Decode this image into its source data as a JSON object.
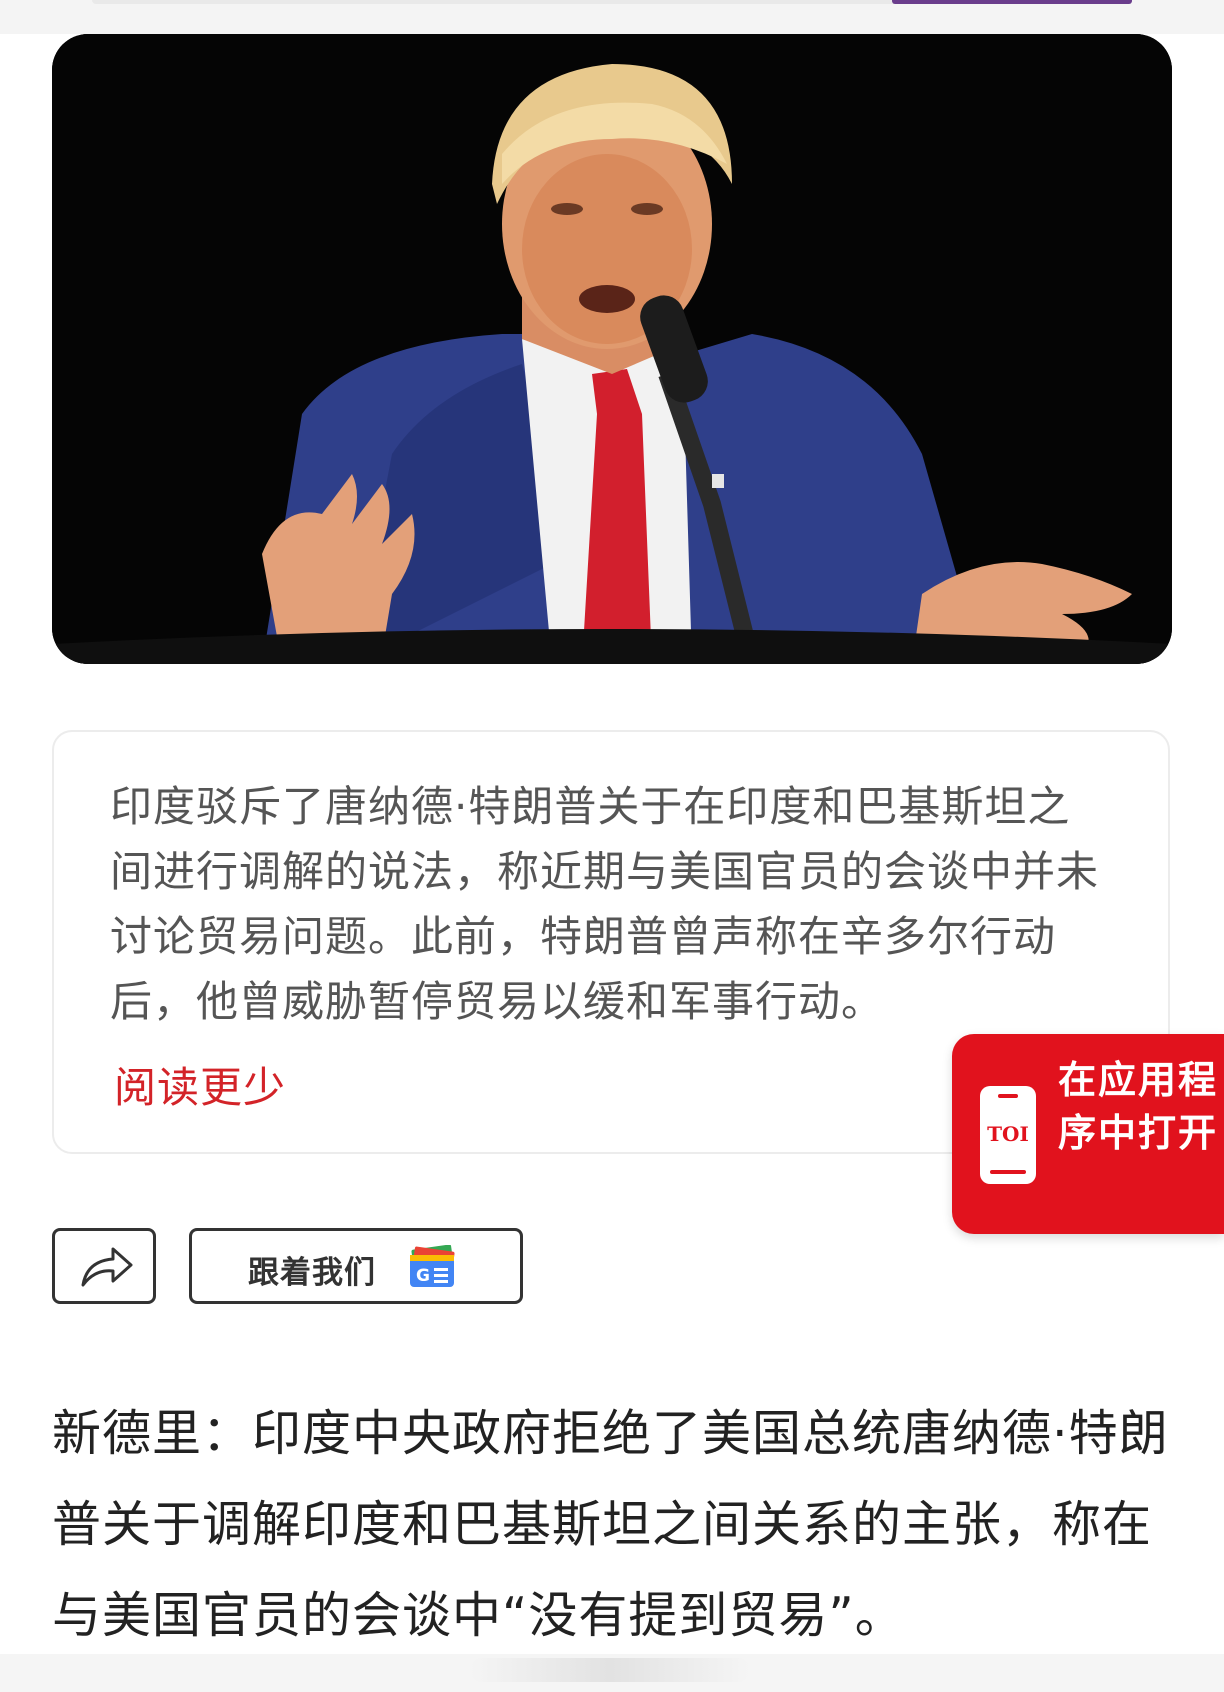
{
  "hero": {
    "image_alt": "",
    "image_icon": "speaker-at-microphone-photo"
  },
  "summary": {
    "text": "印度驳斥了唐纳德·特朗普关于在印度和巴基斯坦之间进行调解的说法，称近期与美国官员的会谈中并未讨论贸易问题。此前，特朗普曾声称在辛多尔行动后，他曾威胁暂停贸易以缓和军事行动。",
    "read_less_label": "阅读更少"
  },
  "open_app": {
    "label": "在应用程序中打开",
    "logo_text": "TOI",
    "brand_color": "#e1121d"
  },
  "actions": {
    "share_icon": "share-arrow-icon",
    "follow_label": "跟着我们",
    "follow_icon": "google-news-icon"
  },
  "article": {
    "body": "新德里：印度中央政府拒绝了美国总统唐纳德·特朗普关于调解印度和巴基斯坦之间关系的主张，称在与美国官员的会谈中“没有提到贸易”。"
  }
}
